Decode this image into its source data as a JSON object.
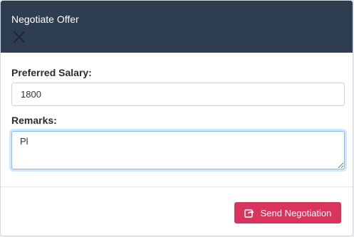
{
  "modal": {
    "title": "Negotiate Offer",
    "close_icon": "close-icon"
  },
  "form": {
    "salary_label": "Preferred Salary:",
    "salary_value": "1800",
    "remarks_label": "Remarks:",
    "remarks_value": "Pl"
  },
  "footer": {
    "send_label": "Send Negotiation",
    "send_icon": "share-icon"
  },
  "colors": {
    "header_bg": "#2e3e50",
    "accent": "#d9345e",
    "focus_border": "#80bdff"
  }
}
